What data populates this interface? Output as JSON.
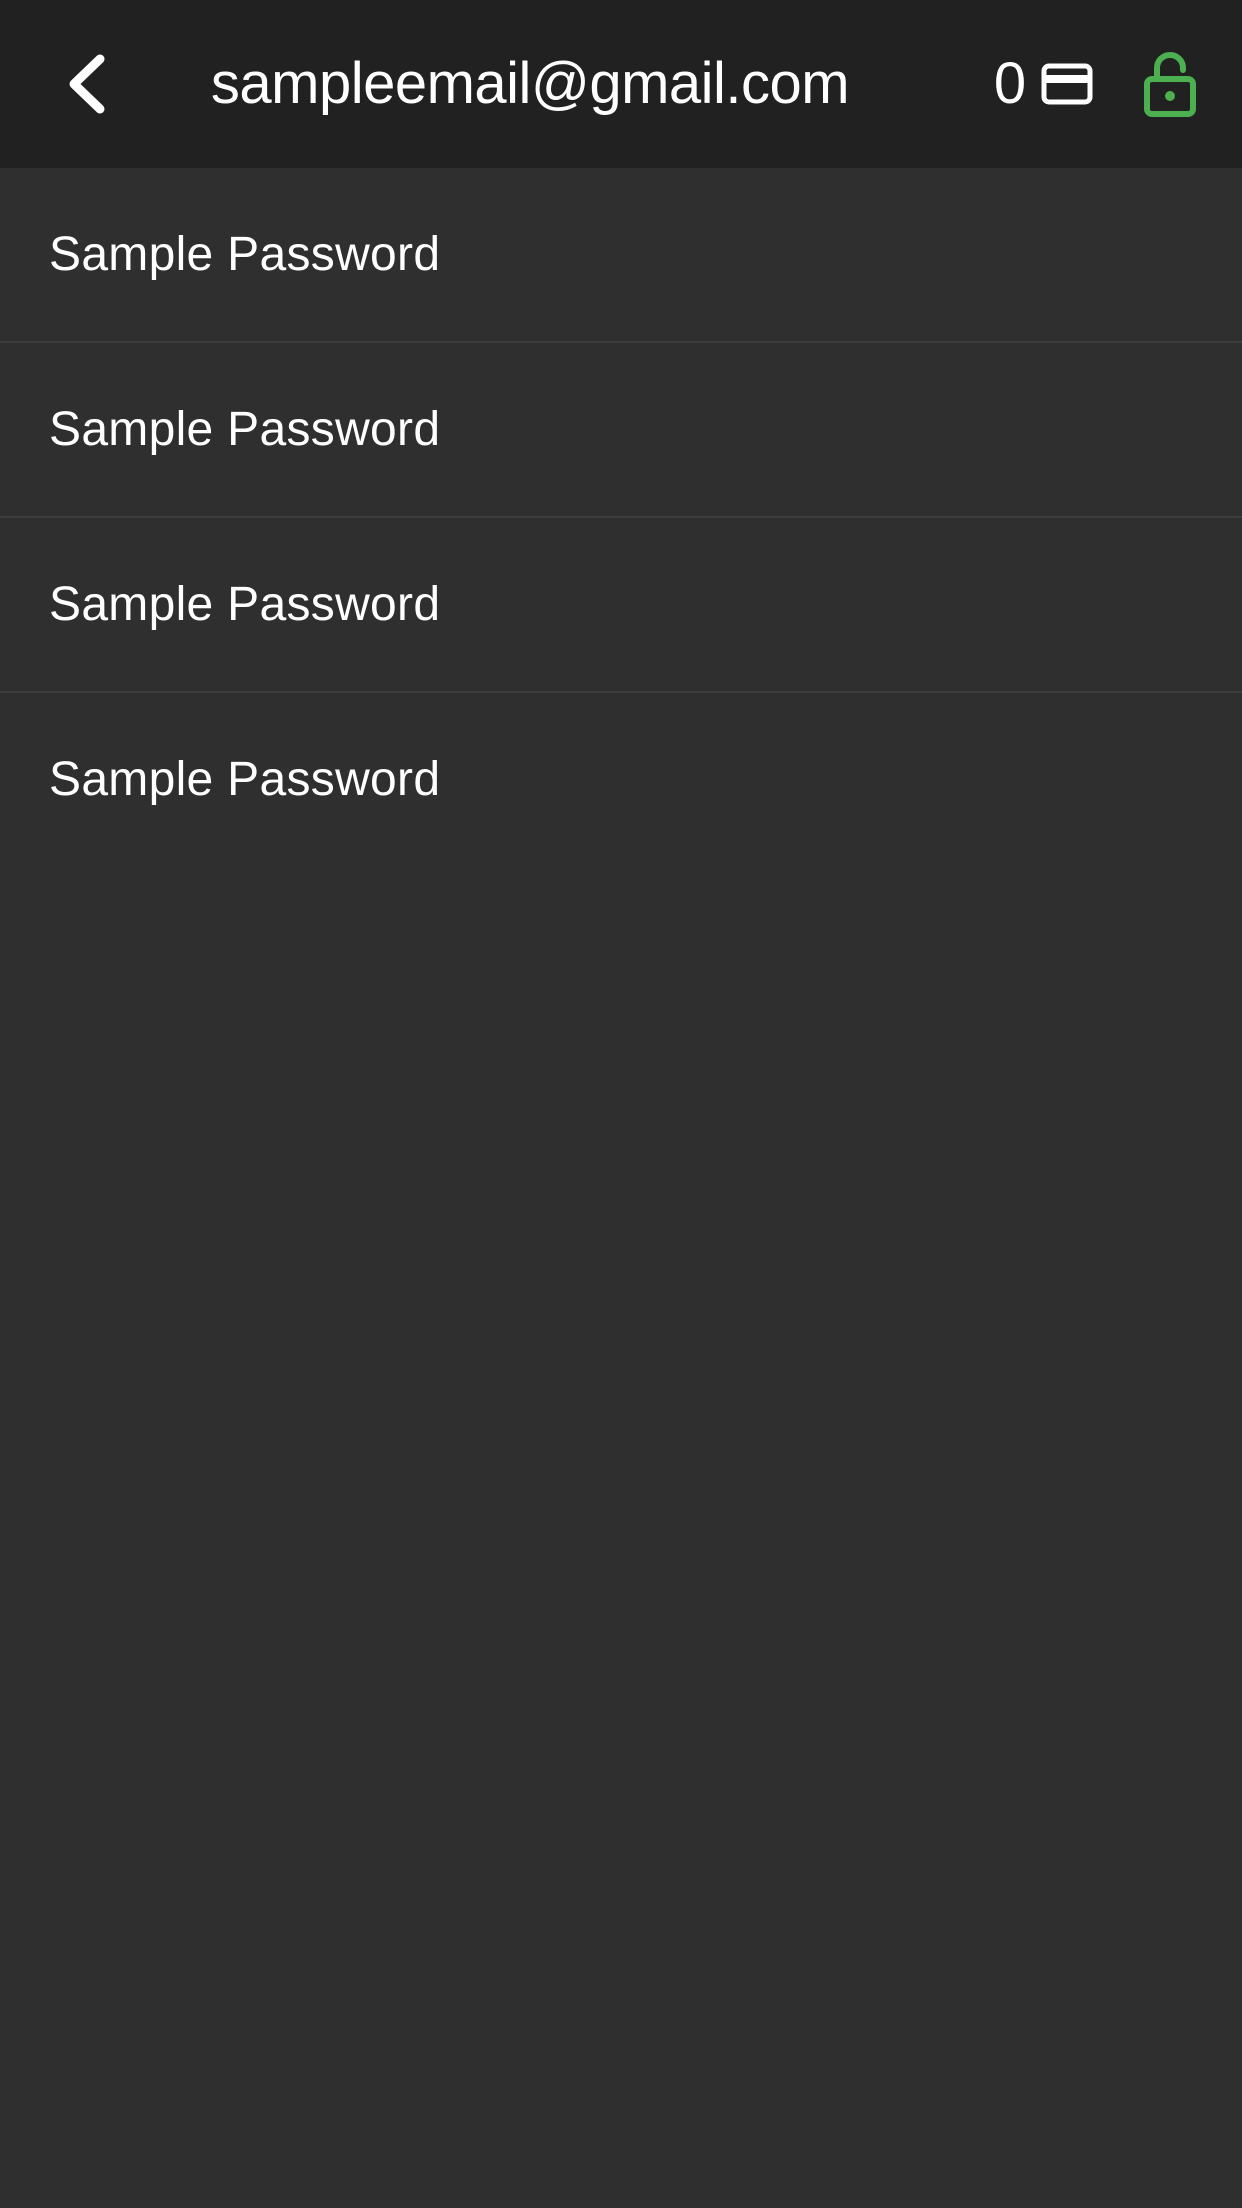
{
  "header": {
    "title": "sampleemail@gmail.com",
    "card_count": "0",
    "back_icon": "chevron-left-icon",
    "card_icon": "credit-card-icon",
    "lock_icon": "unlocked-padlock-icon",
    "lock_state": "unlocked"
  },
  "colors": {
    "header_background": "#212121",
    "page_background": "#2f2f2f",
    "text": "#ffffff",
    "lock_accent": "#4caf50",
    "divider": "#3d3d3d"
  },
  "list": {
    "items": [
      {
        "label": "Sample Password"
      },
      {
        "label": "Sample Password"
      },
      {
        "label": "Sample Password"
      },
      {
        "label": "Sample Password"
      }
    ]
  }
}
